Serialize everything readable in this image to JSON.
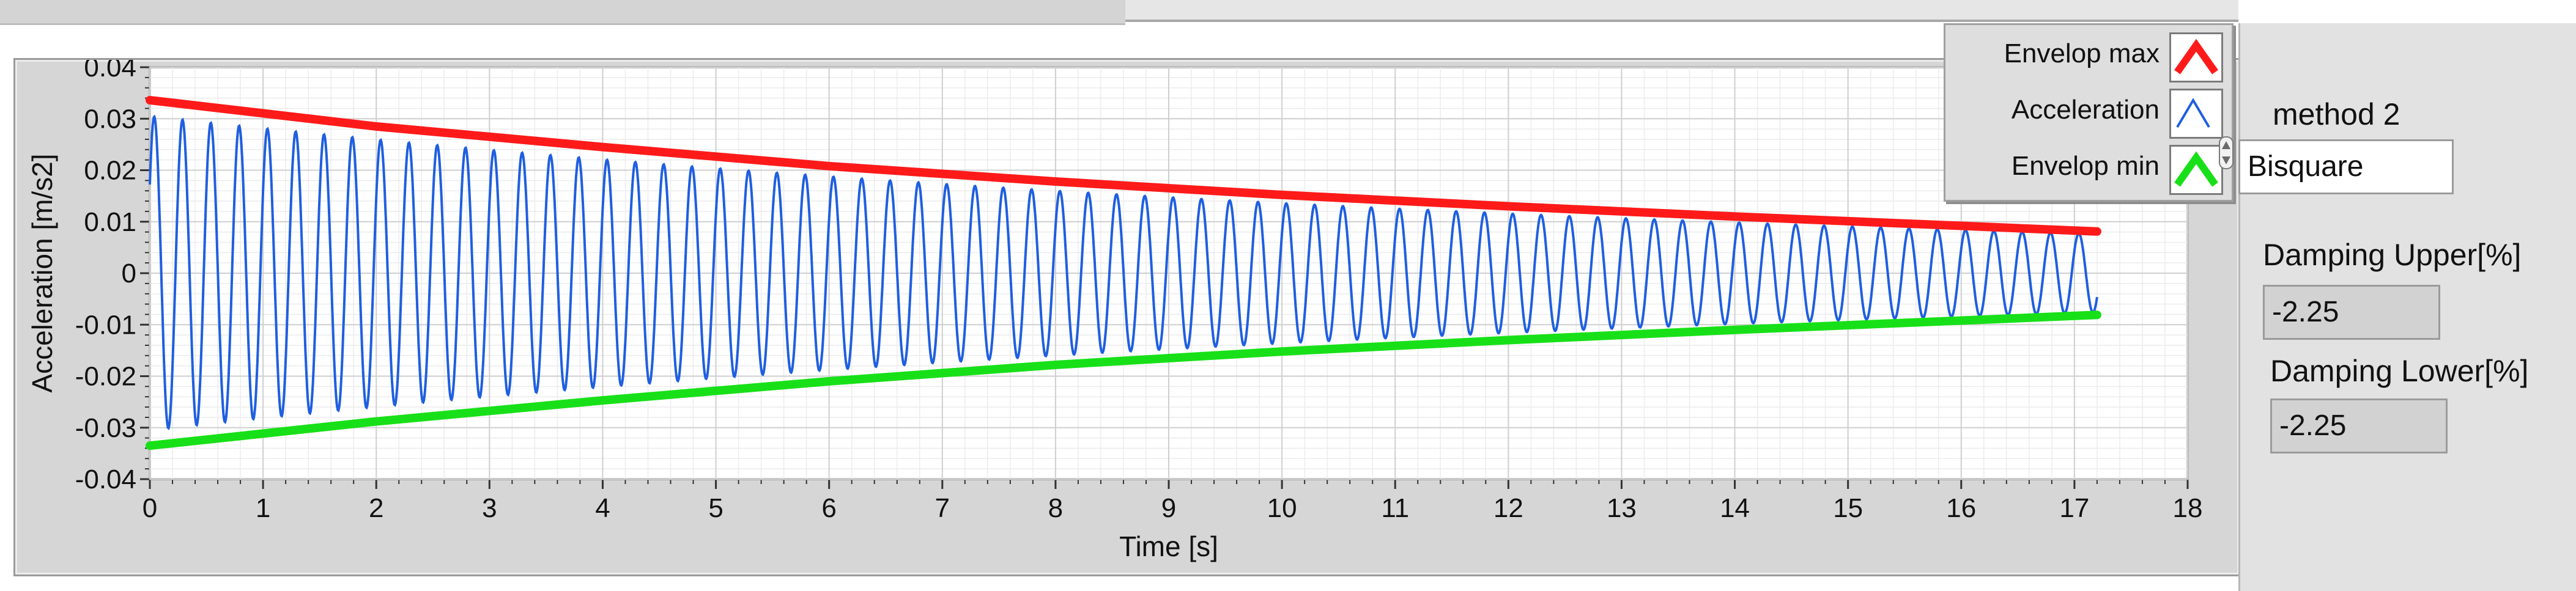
{
  "graph": {
    "xlabel": "Time [s]",
    "ylabel": "Acceleration [m/s2]",
    "x_ticks": [
      "0",
      "1",
      "2",
      "3",
      "4",
      "5",
      "6",
      "7",
      "8",
      "9",
      "10",
      "11",
      "12",
      "13",
      "14",
      "15",
      "16",
      "17",
      "18"
    ],
    "y_ticks": [
      "0.04",
      "0.03",
      "0.02",
      "0.01",
      "0",
      "-0.01",
      "-0.02",
      "-0.03",
      "-0.04"
    ]
  },
  "legend": {
    "items": [
      {
        "label": "Envelop max",
        "color": "#ff1a1a"
      },
      {
        "label": "Acceleration",
        "color": "#1f5fe0"
      },
      {
        "label": "Envelop min",
        "color": "#18e018"
      }
    ]
  },
  "side": {
    "method_label": "method 2",
    "method_value": "Bisquare",
    "upper_label": "Damping Upper[%]",
    "upper_value": "-2.25",
    "lower_label": "Damping Lower[%]",
    "lower_value": "-2.25"
  },
  "chart_data": {
    "type": "line",
    "xlabel": "Time [s]",
    "ylabel": "Acceleration [m/s2]",
    "xlim": [
      0,
      18
    ],
    "ylim": [
      -0.04,
      0.04
    ],
    "grid": true,
    "legend_position": "top-right",
    "signal": {
      "amplitude_start": 0.0305,
      "amplitude_end": 0.0076,
      "frequency_hz": 4.0,
      "t_start": 0,
      "t_end": 17.2
    },
    "series": [
      {
        "name": "Envelop max",
        "color": "#ff1a1a",
        "x": [
          0,
          2,
          4,
          6,
          8,
          10,
          12,
          14,
          16,
          17.2
        ],
        "y": [
          0.0336,
          0.0285,
          0.0245,
          0.0208,
          0.0178,
          0.0152,
          0.013,
          0.011,
          0.0092,
          0.0081
        ]
      },
      {
        "name": "Acceleration",
        "color": "#1f5fe0"
      },
      {
        "name": "Envelop min",
        "color": "#18e018",
        "x": [
          0,
          2,
          4,
          6,
          8,
          10,
          12,
          14,
          16,
          17.2
        ],
        "y": [
          -0.0335,
          -0.0288,
          -0.0247,
          -0.021,
          -0.0178,
          -0.0152,
          -0.013,
          -0.011,
          -0.0092,
          -0.0081
        ]
      }
    ]
  }
}
